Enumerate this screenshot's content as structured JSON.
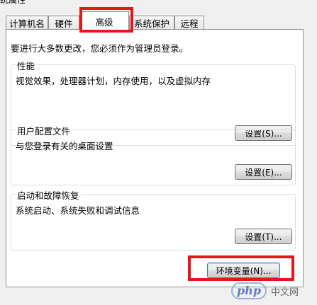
{
  "window": {
    "title_fragment": "统属性"
  },
  "tabs": [
    {
      "label": "计算机名",
      "active": false
    },
    {
      "label": "硬件",
      "active": false
    },
    {
      "label": "高级",
      "active": true
    },
    {
      "label": "系统保护",
      "active": false
    },
    {
      "label": "远程",
      "active": false
    }
  ],
  "intro_text": "要进行大多数更改，您必须作为管理员登录。",
  "groups": {
    "performance": {
      "title": "性能",
      "description": "视觉效果，处理器计划，内存使用，以及虚拟内存",
      "button_label": "设置(S)..."
    },
    "user_profiles": {
      "title": "用户配置文件",
      "description": "与您登录有关的桌面设置",
      "button_label": "设置(E)..."
    },
    "startup_recovery": {
      "title": "启动和故障恢复",
      "description": "系统启动、系统失败和调试信息",
      "button_label": "设置(T)..."
    }
  },
  "env_button_label": "环境变量(N)...",
  "annotation_color": "#e8161b",
  "watermark": {
    "logo": "php",
    "text": "中文网"
  }
}
